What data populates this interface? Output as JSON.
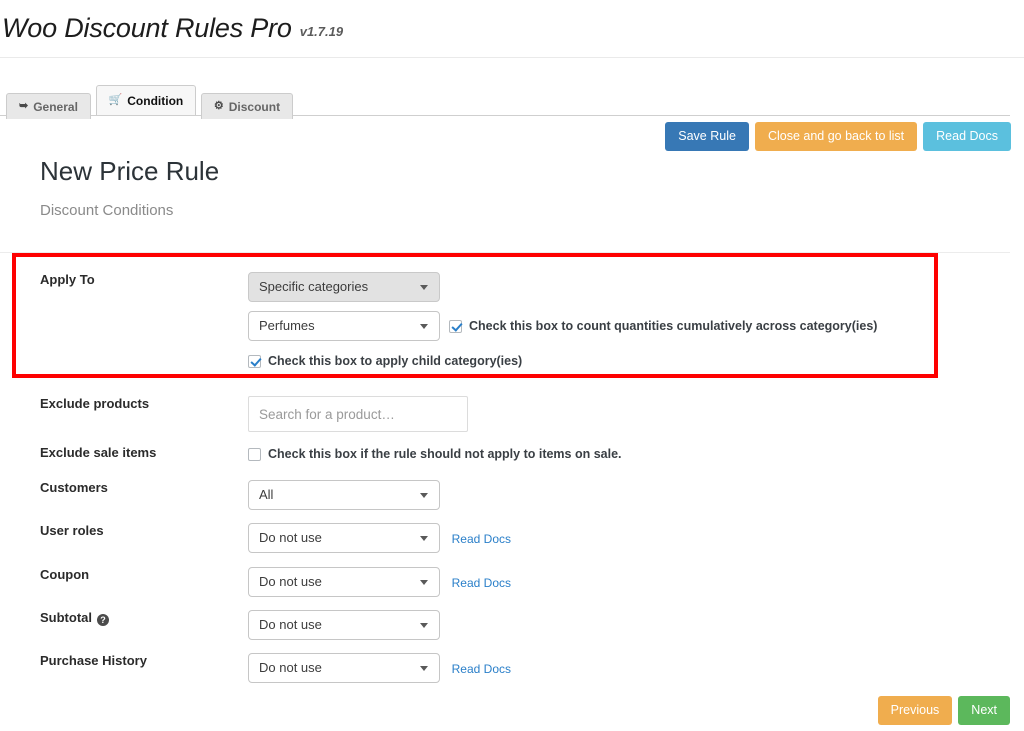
{
  "header": {
    "app_title": "Woo Discount Rules Pro",
    "version": "v1.7.19"
  },
  "tabs": [
    {
      "label": "General",
      "icon": "tag-icon",
      "glyph": "⚑",
      "active": false
    },
    {
      "label": "Condition",
      "icon": "cart-icon",
      "glyph": "Ὥ2",
      "active": true
    },
    {
      "label": "Discount",
      "icon": "gear-icon",
      "glyph": "⚙",
      "active": false
    }
  ],
  "actions": {
    "save_label": "Save Rule",
    "close_label": "Close and go back to list",
    "read_docs_label": "Read Docs"
  },
  "page": {
    "title": "New Price Rule",
    "subtitle": "Discount Conditions"
  },
  "fields": {
    "apply_to": {
      "label": "Apply To",
      "type_value": "Specific categories",
      "category_value": "Perfumes",
      "cumulative_checkbox": {
        "label": "Check this box to count quantities cumulatively across category(ies)",
        "checked": true
      },
      "child_category_checkbox": {
        "label": "Check this box to apply child category(ies)",
        "checked": true
      }
    },
    "exclude_products": {
      "label": "Exclude products",
      "placeholder": "Search for a product…",
      "value": ""
    },
    "exclude_sale_items": {
      "label": "Exclude sale items",
      "checkbox_label": "Check this box if the rule should not apply to items on sale.",
      "checked": false
    },
    "customers": {
      "label": "Customers",
      "value": "All"
    },
    "user_roles": {
      "label": "User roles",
      "value": "Do not use",
      "docs_label": "Read Docs"
    },
    "coupon": {
      "label": "Coupon",
      "value": "Do not use",
      "docs_label": "Read Docs"
    },
    "subtotal": {
      "label": "Subtotal",
      "help_glyph": "?",
      "value": "Do not use"
    },
    "purchase_history": {
      "label": "Purchase History",
      "value": "Do not use",
      "docs_label": "Read Docs"
    }
  },
  "footer": {
    "previous_label": "Previous",
    "next_label": "Next"
  },
  "colors": {
    "save": "#3778b5",
    "close": "#f0ad4e",
    "docs": "#5bc0de",
    "previous": "#f0ad4e",
    "next": "#5cb85c",
    "highlight": "#fe0000",
    "link": "#2a7fc9"
  }
}
